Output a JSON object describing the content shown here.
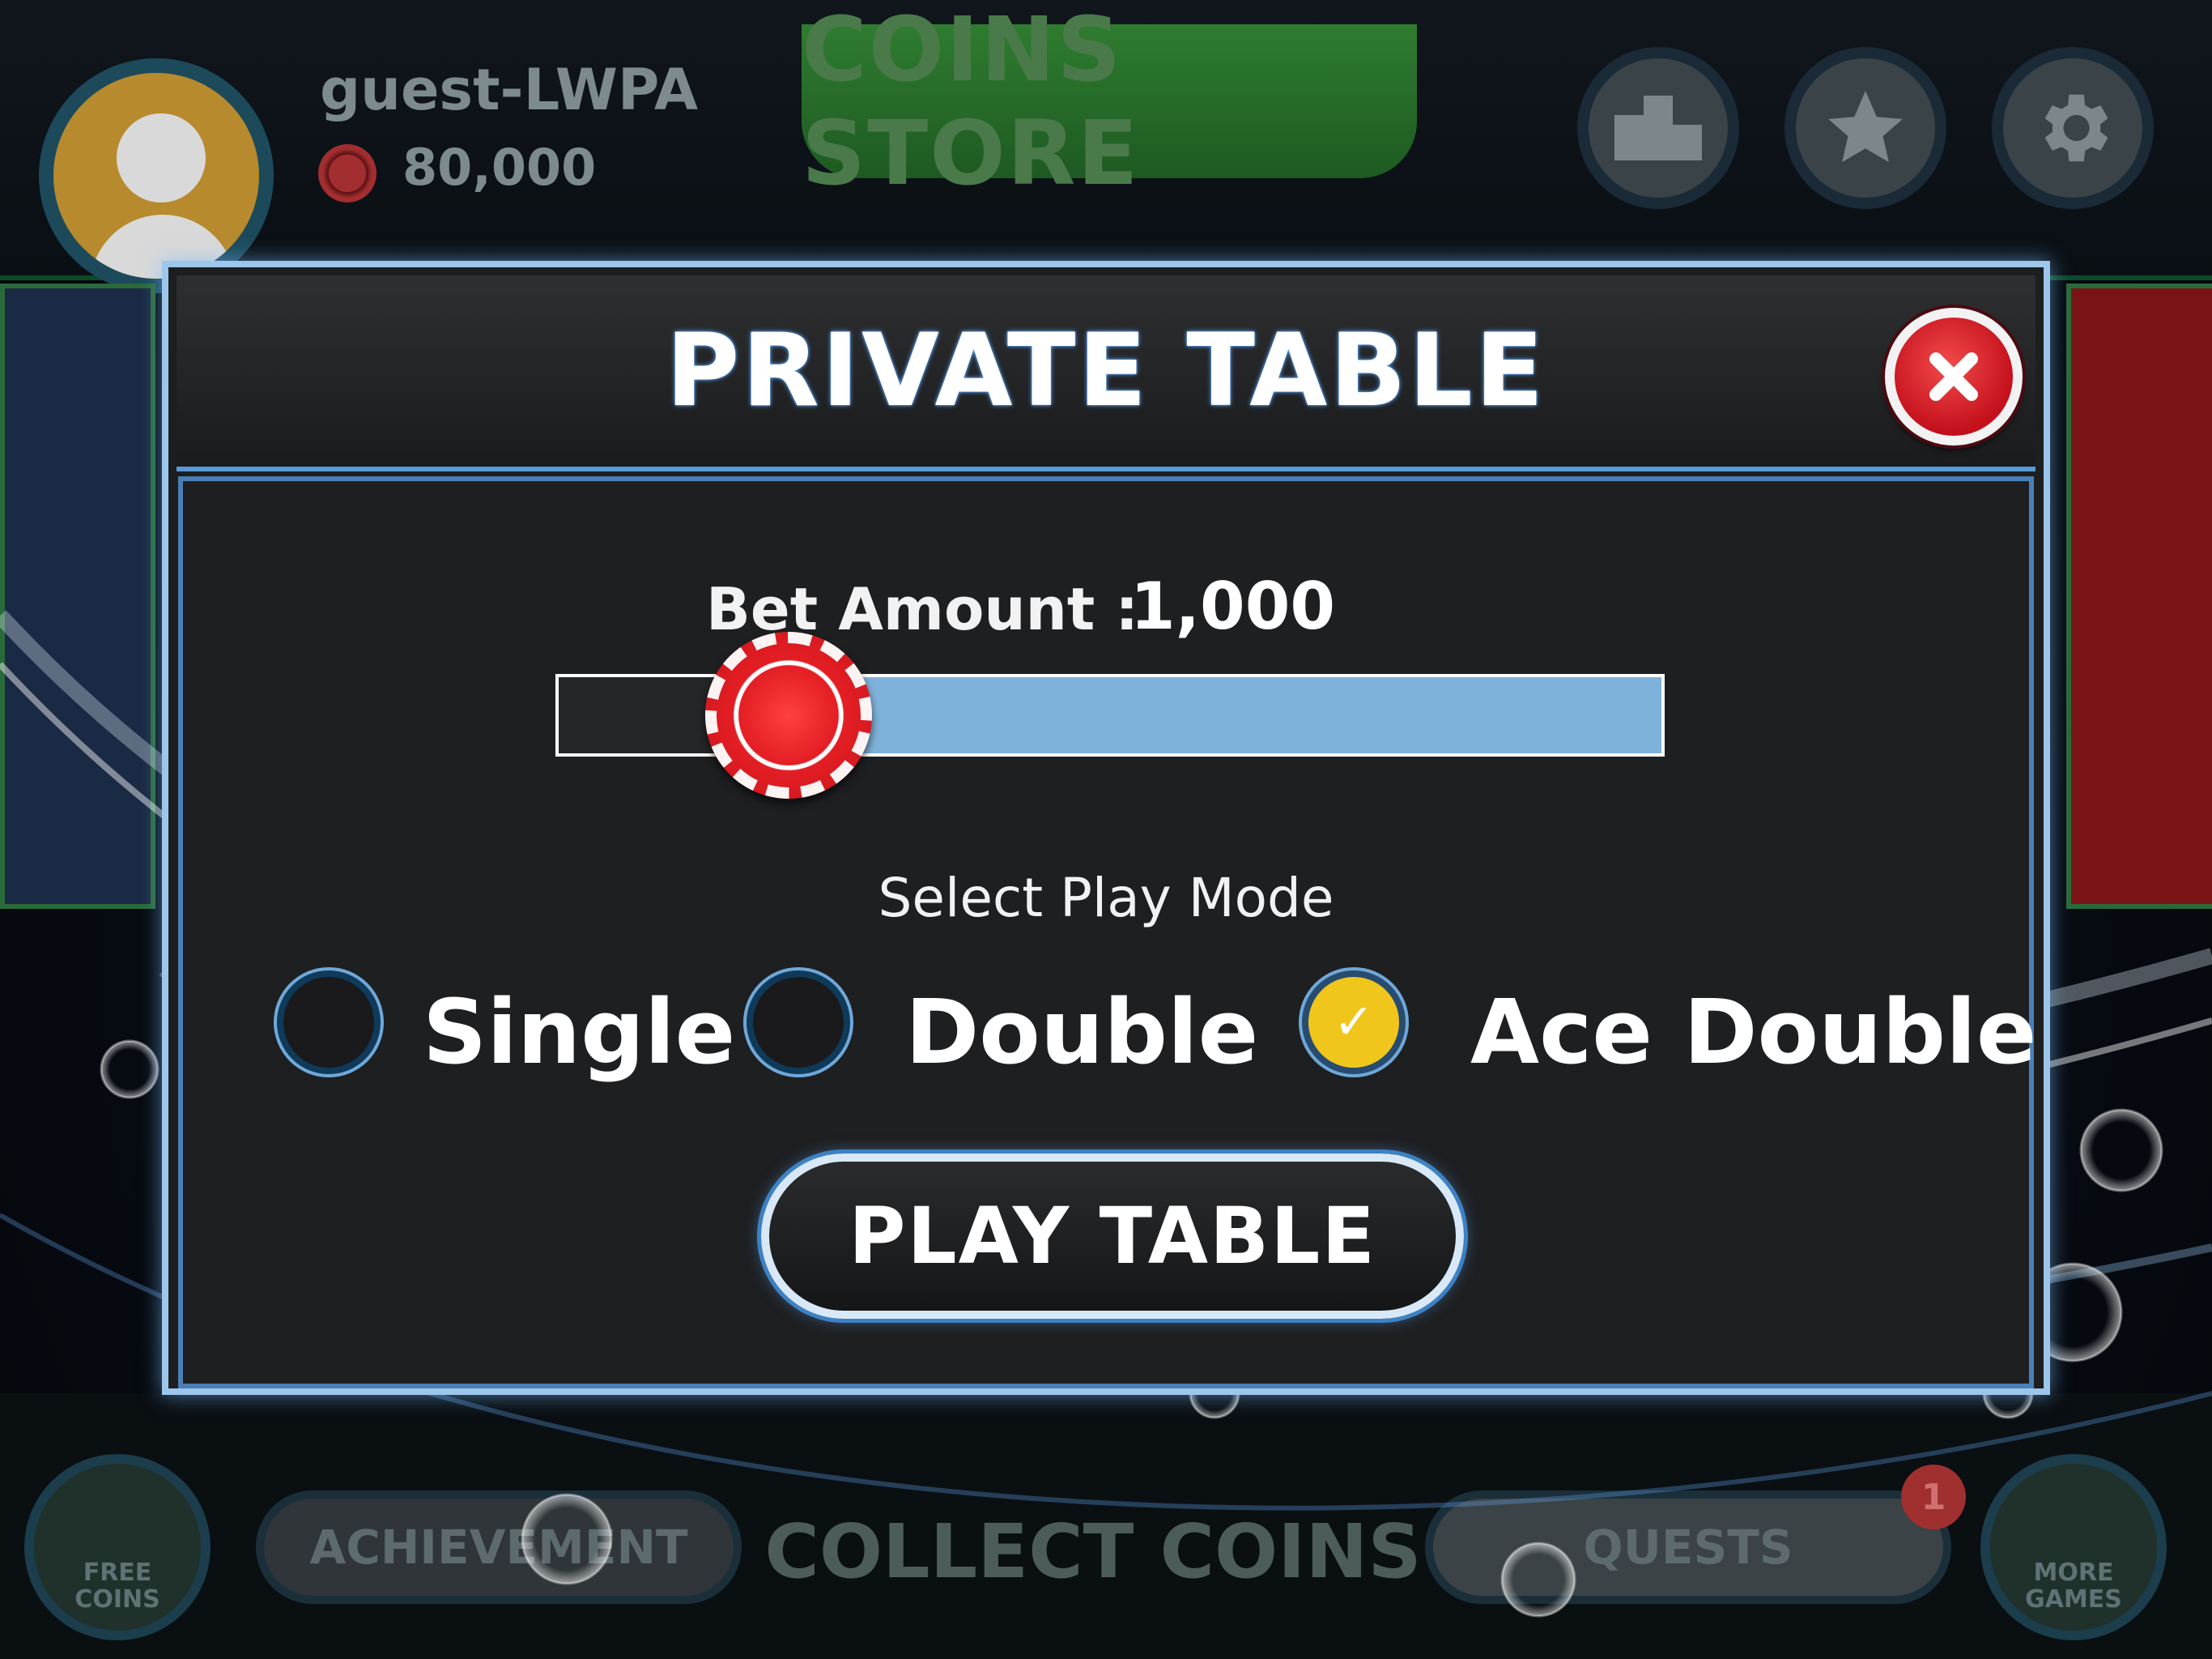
{
  "player": {
    "name": "guest-LWPA",
    "balance": "80,000"
  },
  "header": {
    "coins_store": "COINS STORE"
  },
  "bottom": {
    "free_coins": "FREE COINS",
    "achievement": "ACHIEVEMENT",
    "collect_coins": "COLLECT COINS",
    "quests": "QUESTS",
    "quests_badge": "1",
    "more_games": "MORE GAMES"
  },
  "dialog": {
    "title": "PRIVATE TABLE",
    "bet_label": "Bet Amount :",
    "bet_value": "1,000",
    "slider_level": 0.21,
    "mode_label": "Select Play Mode",
    "modes": [
      {
        "label": "Single",
        "selected": false
      },
      {
        "label": "Double",
        "selected": false
      },
      {
        "label": "Ace Double",
        "selected": true
      }
    ],
    "play_button": "PLAY TABLE"
  },
  "colors": {
    "accent_blue": "#7fb2da",
    "close_red": "#e31e24",
    "selected_yellow": "#f1c61c",
    "store_green": "#2f7c30"
  },
  "icons": [
    "leaderboard-icon",
    "star-icon",
    "gear-icon",
    "close-icon",
    "checkmark-icon",
    "gift-icon",
    "gamepad-icon"
  ]
}
